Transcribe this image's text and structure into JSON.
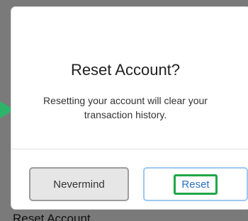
{
  "dialog": {
    "title": "Reset Account?",
    "message": "Resetting your account will clear your transaction history.",
    "cancel_label": "Nevermind",
    "confirm_label": "Reset"
  },
  "background": {
    "partial_heading": "Reset Account"
  },
  "colors": {
    "accent": "#2a6fc7",
    "highlight": "#1fa64a",
    "pointer": "#2fb36b"
  }
}
